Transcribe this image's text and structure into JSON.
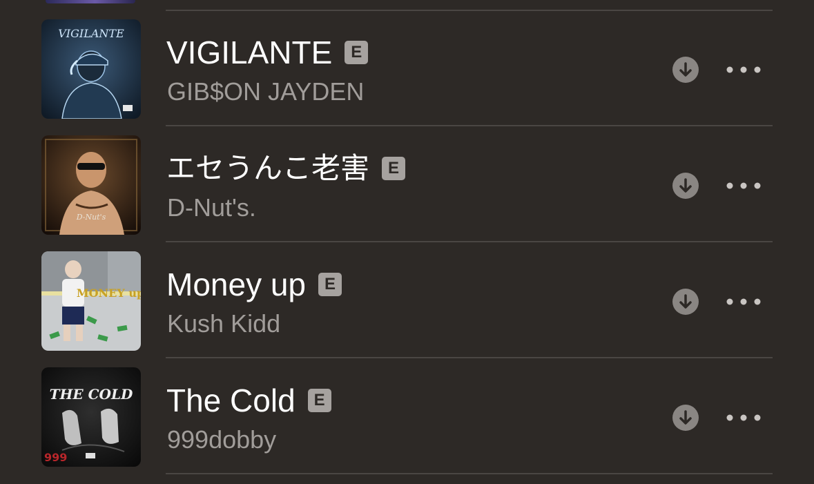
{
  "tracks": [
    {
      "title": "VIGILANTE",
      "explicit_label": "E",
      "artist": "GIB$ON JAYDEN",
      "artwork_text": "VIGILANTE"
    },
    {
      "title": "エセうんこ老害",
      "explicit_label": "E",
      "artist": "D-Nut's.",
      "artwork_text": "D-Nut's"
    },
    {
      "title": "Money up",
      "explicit_label": "E",
      "artist": "Kush Kidd",
      "artwork_text": "MONEY up"
    },
    {
      "title": "The Cold",
      "explicit_label": "E",
      "artist": "999dobby",
      "artwork_text": "THE COLD"
    }
  ],
  "colors": {
    "background": "#2d2926",
    "title": "#ffffff",
    "artist": "#a19d9a",
    "badge": "#a6a29f",
    "icon": "#8a8683",
    "divider": "#4a4643"
  },
  "icons": {
    "download": "arrow-down-circle-icon",
    "more": "ellipsis-icon"
  }
}
